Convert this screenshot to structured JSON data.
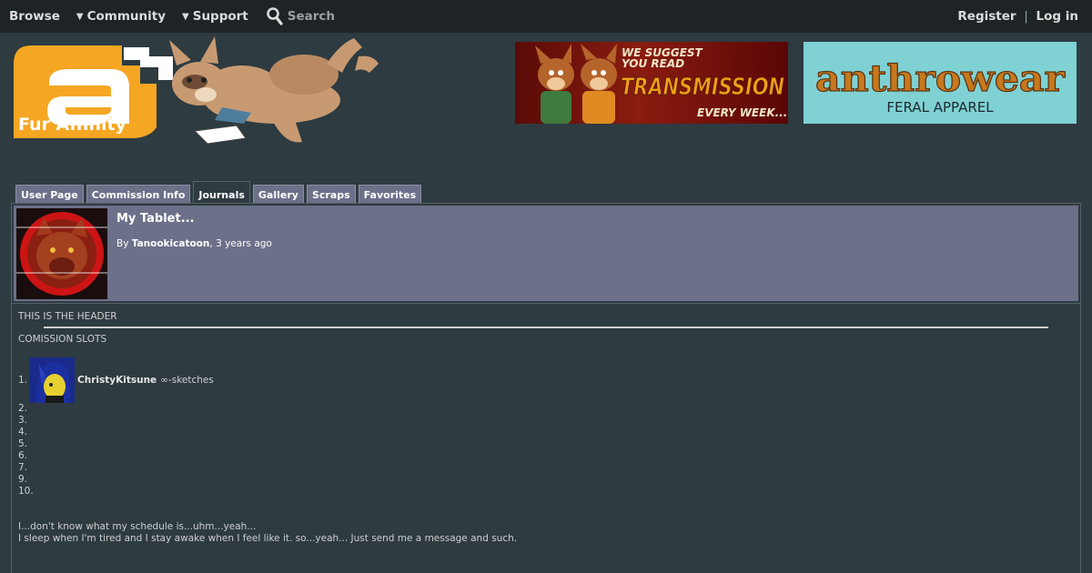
{
  "nav": {
    "browse": "Browse",
    "community": "Community",
    "support": "Support",
    "search_label": "Search",
    "register": "Register",
    "separator": "|",
    "login": "Log in"
  },
  "logo": {
    "text": "Fur Affinity"
  },
  "ads": [
    {
      "line1": "WE SUGGEST",
      "line2": "YOU READ",
      "headline": "TRANSMISSION",
      "tagline": "EVERY WEEK..."
    },
    {
      "headline": "anthrowear",
      "tagline": "FERAL APPAREL",
      "bg": "#7fd1d3"
    }
  ],
  "tabs": [
    "User Page",
    "Commission Info",
    "Journals",
    "Gallery",
    "Scraps",
    "Favorites"
  ],
  "active_tab": "Journals",
  "journal": {
    "title": "My Tablet...",
    "by_prefix": "By",
    "author": "Tanookicatoon",
    "age": ", 3 years ago"
  },
  "content": {
    "header_line": "THIS IS THE HEADER",
    "slots_heading": "COMISSION SLOTS",
    "slot1_number": "1.",
    "slot1_user": "ChristyKitsune",
    "slot1_note": "∞-sketches",
    "numbers": [
      "2.",
      "3.",
      "4.",
      "5.",
      "6.",
      "7.",
      "9.",
      "10."
    ],
    "para1": "I...don't know what my schedule is...uhm...yeah...",
    "para2": "I sleep when I'm tired and I stay awake when I feel like it. so...yeah... Just send me a message and such."
  },
  "colors": {
    "page_bg": "#2e3b41",
    "nav_bg": "#1e2426",
    "tab_bg": "#6c7089",
    "header_bg": "#6c7089",
    "logo_orange": "#f5a623"
  }
}
